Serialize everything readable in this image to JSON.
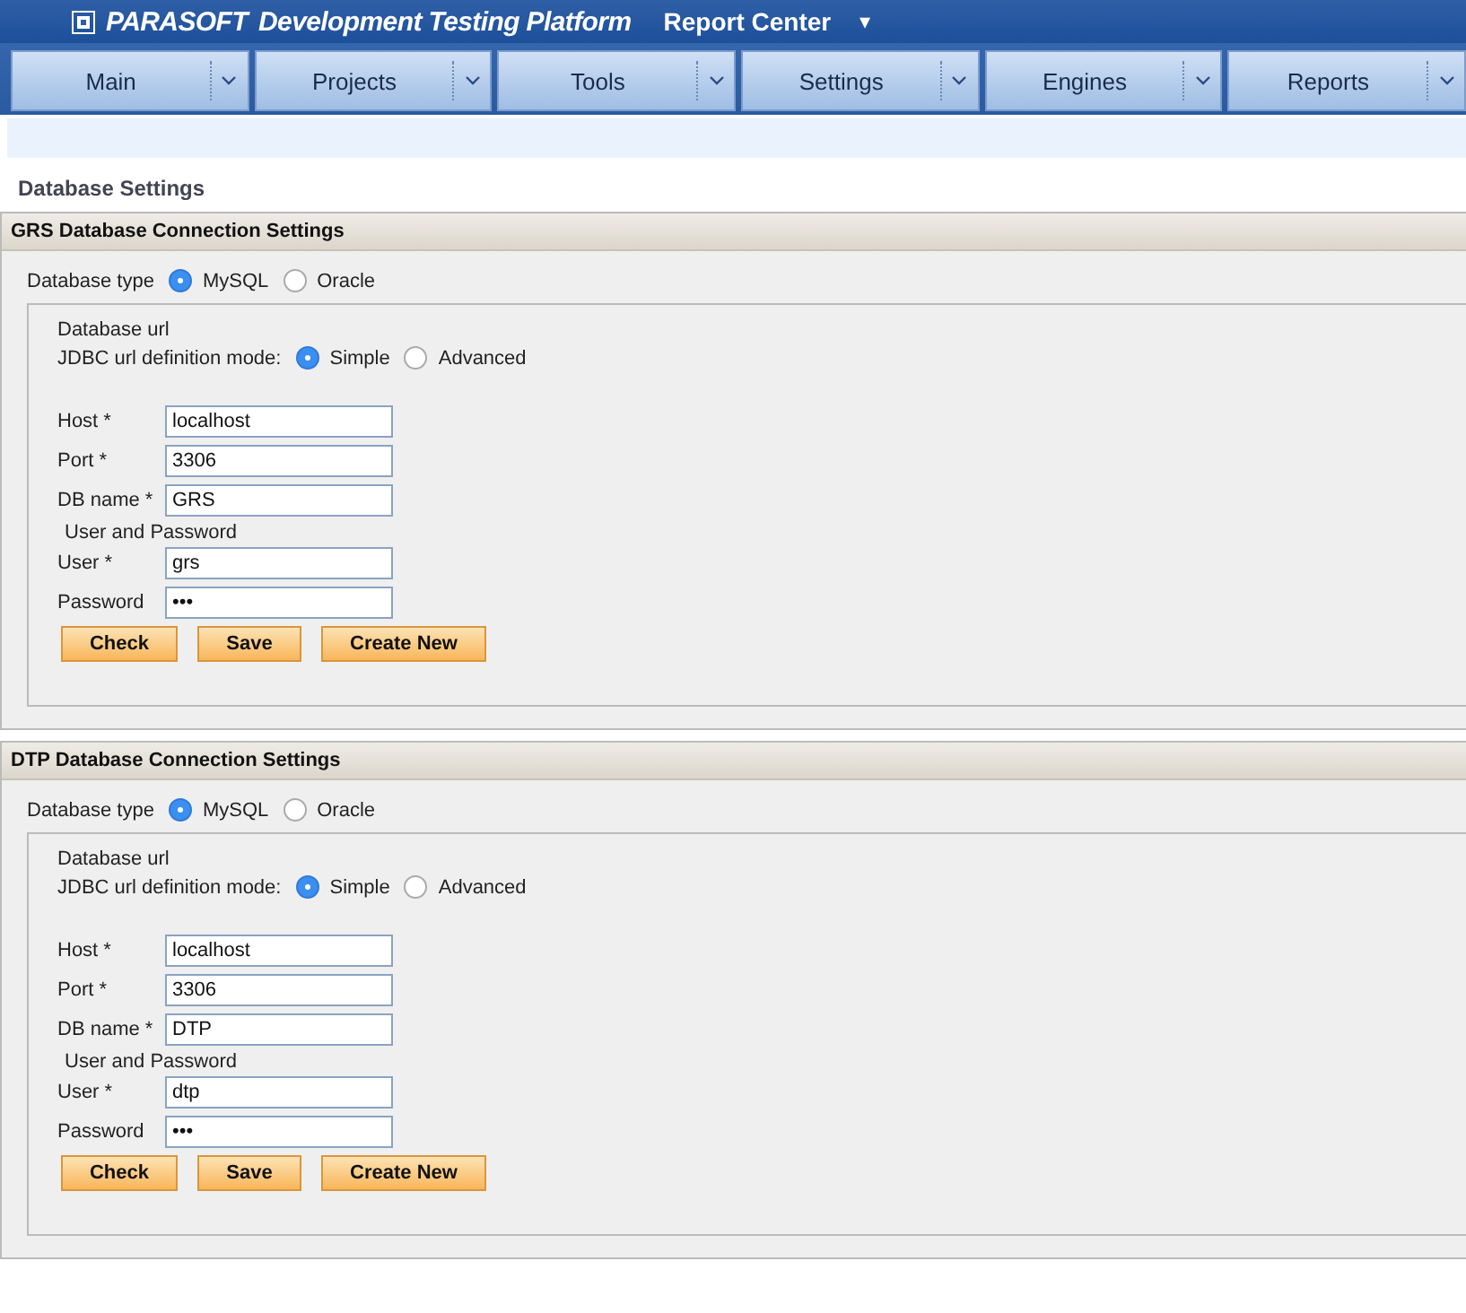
{
  "header": {
    "brand": "PARASOFT",
    "product": "Development Testing Platform",
    "app": "Report Center",
    "app_caret": "▾"
  },
  "nav": [
    {
      "label": "Main"
    },
    {
      "label": "Projects"
    },
    {
      "label": "Tools"
    },
    {
      "label": "Settings"
    },
    {
      "label": "Engines"
    },
    {
      "label": "Reports"
    }
  ],
  "page_title": "Database Settings",
  "sections": [
    {
      "title": "GRS Database Connection Settings",
      "type_label": "Database type",
      "types": [
        {
          "label": "MySQL",
          "selected": true
        },
        {
          "label": "Oracle",
          "selected": false
        }
      ],
      "url_title": "Database url",
      "mode_label": "JDBC url definition mode:",
      "modes": [
        {
          "label": "Simple",
          "selected": true
        },
        {
          "label": "Advanced",
          "selected": false
        }
      ],
      "fields": [
        {
          "label": "Host *",
          "value": "localhost"
        },
        {
          "label": "Port *",
          "value": "3306"
        },
        {
          "label": "DB name *",
          "value": "GRS"
        }
      ],
      "credentials_title": "User and Password",
      "credentials": [
        {
          "label": "User *",
          "value": "grs"
        },
        {
          "label": "Password",
          "value": "•••"
        }
      ],
      "buttons": [
        "Check",
        "Save",
        "Create New"
      ]
    },
    {
      "title": "DTP Database Connection Settings",
      "type_label": "Database type",
      "types": [
        {
          "label": "MySQL",
          "selected": true
        },
        {
          "label": "Oracle",
          "selected": false
        }
      ],
      "url_title": "Database url",
      "mode_label": "JDBC url definition mode:",
      "modes": [
        {
          "label": "Simple",
          "selected": true
        },
        {
          "label": "Advanced",
          "selected": false
        }
      ],
      "fields": [
        {
          "label": "Host *",
          "value": "localhost"
        },
        {
          "label": "Port *",
          "value": "3306"
        },
        {
          "label": "DB name *",
          "value": "DTP"
        }
      ],
      "credentials_title": "User and Password",
      "credentials": [
        {
          "label": "User *",
          "value": "dtp"
        },
        {
          "label": "Password",
          "value": "•••"
        }
      ],
      "buttons": [
        "Check",
        "Save",
        "Create New"
      ]
    }
  ]
}
